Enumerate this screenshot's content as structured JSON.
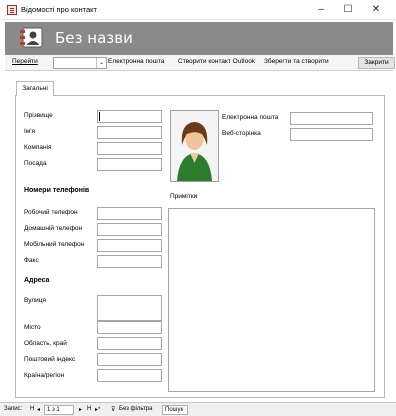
{
  "window": {
    "title": "Відомості про контакт",
    "minimize": "–",
    "maximize": "☐",
    "close": "✕"
  },
  "header": {
    "title": "Без назви",
    "icon": "contact-card-icon"
  },
  "toolbar": {
    "goto_label": "Перейти",
    "goto_value": "",
    "email_label": "Електронна пошта",
    "outlook_label": "Створити контакт Outlook",
    "save_new_label": "Зберегти та створити",
    "close_label": "Закрити"
  },
  "tabs": [
    {
      "label": "Загальні",
      "selected": true
    }
  ],
  "form": {
    "fields": {
      "last_name": "Прізвище",
      "first_name": "Ім'я",
      "company": "Компанія",
      "job_title": "Посада"
    },
    "phones_heading": "Номери телефонів",
    "phones": {
      "business": "Робочий телефон",
      "home": "Домашній телефон",
      "mobile": "Мобільний телефон",
      "fax": "Факс"
    },
    "address_heading": "Адреса",
    "address": {
      "street": "Вулиця",
      "city": "Місто",
      "state": "Область, край",
      "zip": "Поштовий індекс",
      "country": "Країна/регіон"
    },
    "email_label": "Електронна пошта",
    "webpage_label": "Веб-сторінка",
    "notes_label": "Примітки",
    "photo_icon": "person-silhouette-icon"
  },
  "statusbar": {
    "record_label": "Запис:",
    "first": "H",
    "prev": "◂",
    "position": "1 з 1",
    "next": "▸",
    "last": "H",
    "new": "▸*",
    "filter_label": "Без фільтра",
    "search_label": "Пошук"
  },
  "colors": {
    "header_bg": "#8a8a8a",
    "header_text": "#ffffff",
    "photo_jacket": "#2e7d2e",
    "photo_hair": "#6a3b17"
  }
}
